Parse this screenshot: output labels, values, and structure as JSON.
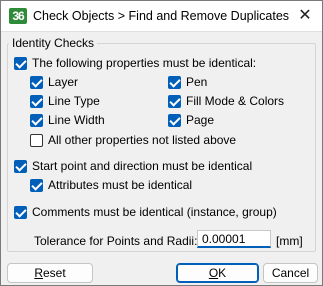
{
  "window": {
    "app_icon": "36",
    "title": "Check Objects > Find and Remove Duplicates",
    "close_symbol": "✕"
  },
  "group": {
    "legend": "Identity Checks"
  },
  "checks": {
    "following_props": {
      "label": "The following properties must be identical:",
      "checked": true
    },
    "layer": {
      "label": "Layer",
      "checked": true
    },
    "pen": {
      "label": "Pen",
      "checked": true
    },
    "line_type": {
      "label": "Line Type",
      "checked": true
    },
    "fill_mode": {
      "label": "Fill Mode & Colors",
      "checked": true
    },
    "line_width": {
      "label": "Line Width",
      "checked": true
    },
    "page": {
      "label": "Page",
      "checked": true
    },
    "all_other": {
      "label": "All other properties not listed above",
      "checked": false
    },
    "start_point": {
      "label": "Start point and direction must be identical",
      "checked": true
    },
    "attributes": {
      "label": "Attributes must be identical",
      "checked": true
    },
    "comments": {
      "label": "Comments must be identical (instance, group)",
      "checked": true
    }
  },
  "tolerance": {
    "label": "Tolerance for Points and Radii:",
    "value": "0.00001",
    "unit": "[mm]"
  },
  "buttons": {
    "reset": {
      "mnemonic": "R",
      "rest": "eset"
    },
    "ok": {
      "mnemonic": "O",
      "rest": "K"
    },
    "cancel": "Cancel"
  },
  "colors": {
    "accent": "#005fb8",
    "app_icon": "#2e8b3a",
    "background": "#f0f0f0"
  }
}
